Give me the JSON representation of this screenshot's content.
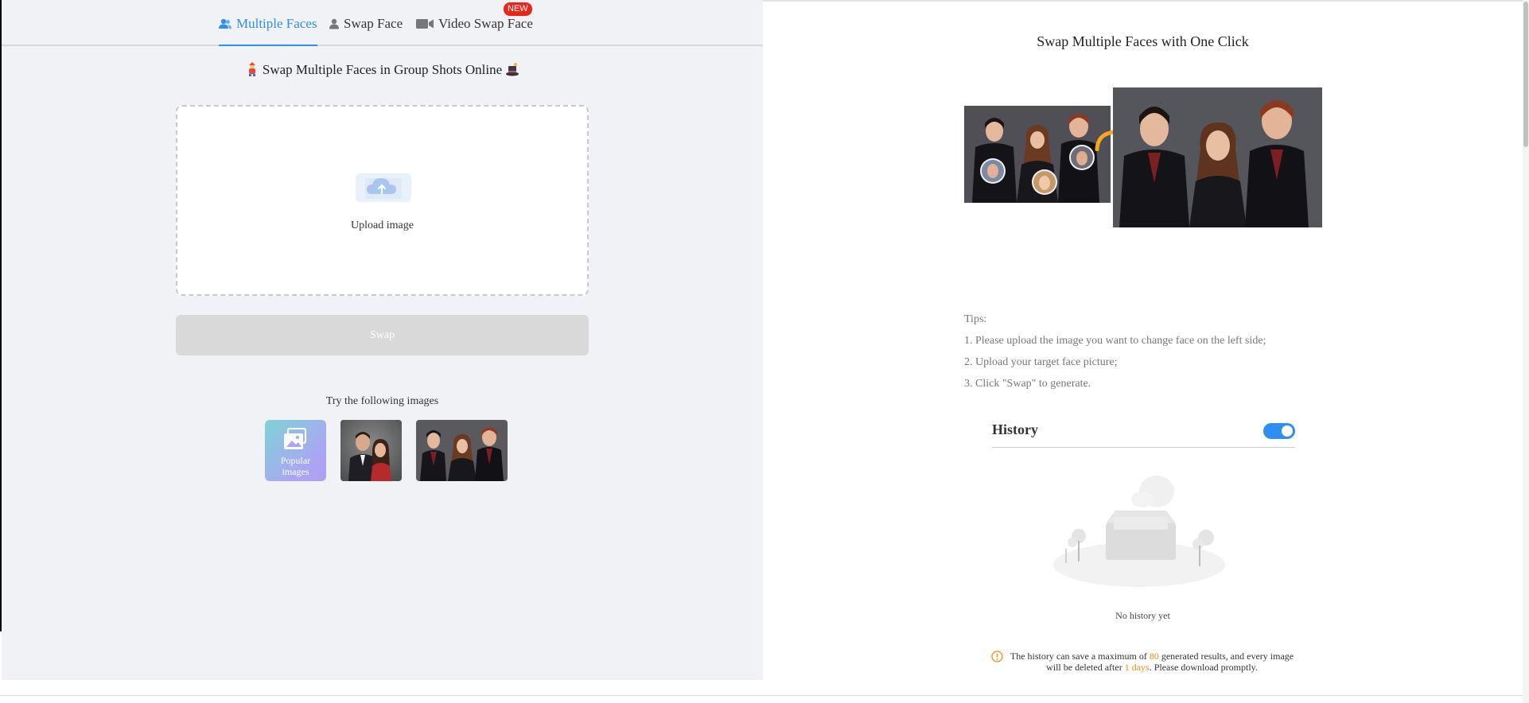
{
  "tabs": [
    {
      "label": "Multiple Faces",
      "icon": "user-group-icon",
      "active": true
    },
    {
      "label": "Swap Face",
      "icon": "user-icon",
      "active": false
    },
    {
      "label": "Video Swap Face",
      "icon": "video-camera-icon",
      "active": false
    }
  ],
  "new_badge": "NEW",
  "left_panel": {
    "title": "Swap Multiple Faces in Group Shots Online",
    "upload_label": "Upload image",
    "swap_button": "Swap",
    "try_label": "Try the following images",
    "popular_label_line1": "Popular",
    "popular_label_line2": "images"
  },
  "right_panel": {
    "title": "Swap Multiple Faces with One Click",
    "tips": {
      "heading": "Tips:",
      "items": [
        "1. Please upload the image you want to change face on the left side;",
        "2. Upload your target face picture;",
        "3. Click \"Swap\" to generate."
      ]
    },
    "history": {
      "title": "History",
      "toggle_on": true,
      "empty_text": "No history yet",
      "note_prefix": "The history can save a maximum of ",
      "note_max": "80",
      "note_middle": " generated results, and every image will be deleted after ",
      "note_days": "1 days",
      "note_suffix": ". Please download promptly."
    }
  },
  "colors": {
    "accent": "#2f8ff0",
    "badge": "#e8261c",
    "highlight": "#ef8b0c",
    "left_bg": "#f1f2f6",
    "swap_disabled": "#d9d9d9"
  }
}
